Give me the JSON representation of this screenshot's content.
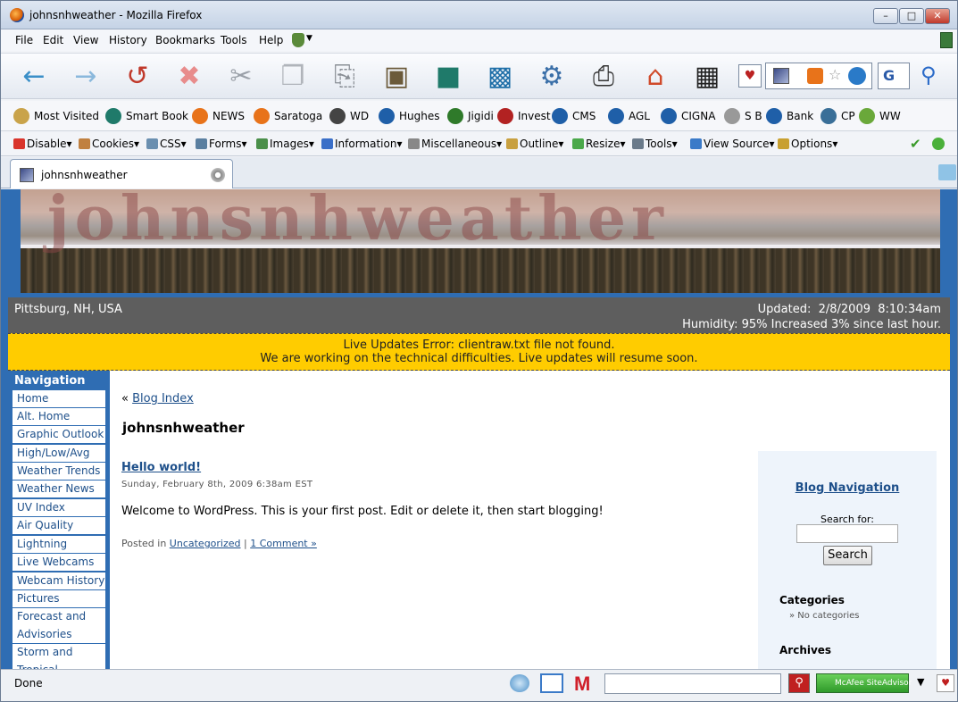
{
  "window": {
    "title": "johnsnhweather - Mozilla Firefox",
    "min": "–",
    "max": "□",
    "close": "✕"
  },
  "menus": [
    "File",
    "Edit",
    "View",
    "History",
    "Bookmarks",
    "Tools",
    "Help"
  ],
  "toolbar": [
    {
      "name": "back",
      "icon": "arrow-left-icon",
      "glyph": "←",
      "color": "#3a8fc8"
    },
    {
      "name": "forward",
      "icon": "arrow-right-icon",
      "glyph": "→",
      "color": "#8ab8dc"
    },
    {
      "name": "reload",
      "icon": "reload-icon",
      "glyph": "↺",
      "color": "#c0392b"
    },
    {
      "name": "stop",
      "icon": "stop-icon",
      "glyph": "✖",
      "color": "#e88c8c"
    },
    {
      "name": "cut",
      "icon": "scissors-icon",
      "glyph": "✂",
      "color": "#9aa0a8"
    },
    {
      "name": "copy",
      "icon": "copy-icon",
      "glyph": "❐",
      "color": "#b0b4ba"
    },
    {
      "name": "paste",
      "icon": "paste-icon",
      "glyph": "⎘",
      "color": "#8a8f96"
    },
    {
      "name": "select",
      "icon": "select-icon",
      "glyph": "▣",
      "color": "#6b5a3a"
    },
    {
      "name": "book",
      "icon": "book-icon",
      "glyph": "■",
      "color": "#1f7a6a"
    },
    {
      "name": "save",
      "icon": "floppy-icon",
      "glyph": "▩",
      "color": "#1f6fa8"
    },
    {
      "name": "folder-settings",
      "icon": "folder-gear-icon",
      "glyph": "⚙",
      "color": "#3a6fa8"
    },
    {
      "name": "print",
      "icon": "printer-icon",
      "glyph": "⎙",
      "color": "#333333"
    },
    {
      "name": "home",
      "icon": "home-icon",
      "glyph": "⌂",
      "color": "#d04a2a"
    },
    {
      "name": "settings",
      "icon": "gear-grid-icon",
      "glyph": "▦",
      "color": "#222222"
    }
  ],
  "bookmarks": [
    {
      "label": "Most Visited",
      "icon": "magnifier-icon",
      "color": "#c9a34a"
    },
    {
      "label": "Smart Book",
      "icon": "book-icon",
      "color": "#1f7a6a"
    },
    {
      "label": "NEWS",
      "icon": "rss-icon",
      "color": "#e8731a"
    },
    {
      "label": "Saratoga",
      "icon": "rss-icon",
      "color": "#e8731a"
    },
    {
      "label": "WD",
      "icon": "storm-cloud-icon",
      "color": "#444444"
    },
    {
      "label": "Hughes",
      "icon": "globe-search-icon",
      "color": "#1f5fa8"
    },
    {
      "label": "Jigidi",
      "icon": "puzzle-icon",
      "color": "#2f7a2a"
    },
    {
      "label": "Invest",
      "icon": "info-icon",
      "color": "#b22222"
    },
    {
      "label": "CMS",
      "icon": "globe-search-icon",
      "color": "#1f5fa8"
    },
    {
      "label": "AGL",
      "icon": "globe-search-icon",
      "color": "#1f5fa8"
    },
    {
      "label": "CIGNA",
      "icon": "globe-search-icon",
      "color": "#1f5fa8"
    },
    {
      "label": "S B",
      "icon": "chart-icon",
      "color": "#999999"
    },
    {
      "label": "Bank",
      "icon": "globe-search-icon",
      "color": "#1f5fa8"
    },
    {
      "label": "CP",
      "icon": "cp-icon",
      "color": "#3a6f98"
    },
    {
      "label": "WW",
      "icon": "crescent-icon",
      "color": "#6aa83a"
    }
  ],
  "devbar": [
    {
      "label": "Disable",
      "color": "#d9342b"
    },
    {
      "label": "Cookies",
      "color": "#c08040"
    },
    {
      "label": "CSS",
      "color": "#6a8fb0"
    },
    {
      "label": "Forms",
      "color": "#5a7fa0"
    },
    {
      "label": "Images",
      "color": "#4a8f4a"
    },
    {
      "label": "Information",
      "color": "#3a6fc8"
    },
    {
      "label": "Miscellaneous",
      "color": "#888888"
    },
    {
      "label": "Outline",
      "color": "#c8a040"
    },
    {
      "label": "Resize",
      "color": "#4aa84a"
    },
    {
      "label": "Tools",
      "color": "#6a7a8a"
    },
    {
      "label": "View Source",
      "color": "#3a7ac8"
    },
    {
      "label": "Options",
      "color": "#c8a030"
    }
  ],
  "tab": {
    "label": "johnsnhweather"
  },
  "site": {
    "banner_title": "johnsnhweather",
    "location": "Pittsburg, NH, USA",
    "updated": "Updated:  2/8/2009  8:10:34am",
    "humidity": "Humidity: 95% Increased 3% since last hour.",
    "alert_line1": "Live Updates Error: clientraw.txt file not found.",
    "alert_line2": "We are working on the technical difficulties. Live updates will resume soon."
  },
  "navigation": {
    "heading": "Navigation",
    "items": [
      "Home",
      "Alt. Home",
      "Graphic Outlook",
      "High/Low/Avg",
      "Weather Trends",
      "Weather News",
      "UV Index",
      "Air Quality",
      "Lightning",
      "Live Webcams",
      "Webcam History",
      "Pictures",
      "Forecast and",
      "Advisories",
      "Storm and",
      "Tropical"
    ]
  },
  "blog": {
    "back_prefix": "«",
    "back_link": "Blog Index",
    "site_title": "johnsnhweather",
    "post_title": "Hello world!",
    "post_date": "Sunday, February 8th, 2009 6:38am EST",
    "post_body": "Welcome to WordPress. This is your first post. Edit or delete it, then start blogging!",
    "posted_in": "Posted in",
    "category_link": "Uncategorized",
    "separator": "|",
    "comments_link": "1 Comment »"
  },
  "blog_sidebar": {
    "nav_title": "Blog Navigation",
    "search_label": "Search for:",
    "search_value": "",
    "search_button": "Search",
    "categories_heading": "Categories",
    "categories_empty": "» No categories",
    "archives_heading": "Archives"
  },
  "status": {
    "text": "Done",
    "mcafee": "McAfee SiteAdvisor"
  }
}
